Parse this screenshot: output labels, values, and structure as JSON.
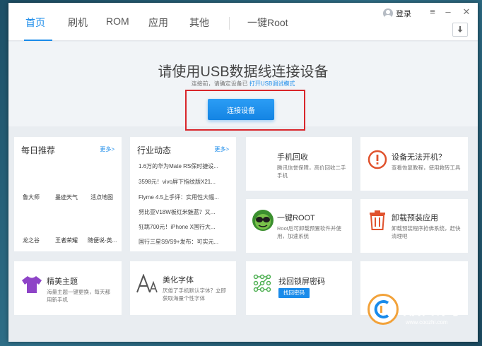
{
  "nav": {
    "tabs": [
      "首页",
      "刷机",
      "ROM",
      "应用",
      "其他",
      "一键Root"
    ],
    "login": "登录",
    "menu_icon": "hamburger-icon",
    "minimize_icon": "minimize-icon",
    "close_icon": "close-icon",
    "download_icon": "download-icon"
  },
  "hero": {
    "title": "请使用USB数据线连接设备",
    "subtitle_prefix": "连接前，请确定设备已",
    "subtitle_link": "打开USB调试模式",
    "connect_button": "连接设备"
  },
  "daily": {
    "title": "每日推荐",
    "more": "更多>",
    "apps": [
      "鲁大师",
      "墨迹天气",
      "活点地图",
      "龙之谷",
      "王者荣耀",
      "随便说-英..."
    ]
  },
  "industry": {
    "title": "行业动态",
    "more": "更多>",
    "news": [
      "1.6万的华为Mate RS保时捷设...",
      "3598元！vivo屏下指纹版X21...",
      "Flyme 4.5上手评：实用性大幅...",
      "努比亚V18W板红米魅蓝？又...",
      "狂跳700元！iPhone X国行大...",
      "国行三星S9/S9+发布：可实元..."
    ]
  },
  "features": {
    "recycle": {
      "title": "手机回收",
      "desc": "腾讯信誉保障，高价回收二手手机"
    },
    "boot": {
      "title": "设备无法开机？",
      "desc": "查看恢复教程，使用救砖工具"
    },
    "root": {
      "title": "一键ROOT",
      "desc": "Root后可卸载预置软件并使用，加速系统"
    },
    "uninstall": {
      "title": "卸载预装应用",
      "desc": "卸载预装程序抢佛系统，赶快清理吧"
    },
    "theme": {
      "title": "精美主题",
      "desc": "海量主题一键更换，每天都用新手机"
    },
    "font": {
      "title": "美化字体",
      "desc": "厌倦了手机默认字体？立即获取海量个性字体"
    },
    "unlock": {
      "title": "找回锁屏密码",
      "button": "找回密码"
    }
  },
  "watermark": {
    "brand": "酷知网",
    "url": "www.coozhi.com"
  },
  "colors": {
    "accent": "#1a8bea",
    "highlight": "#d9262b"
  }
}
